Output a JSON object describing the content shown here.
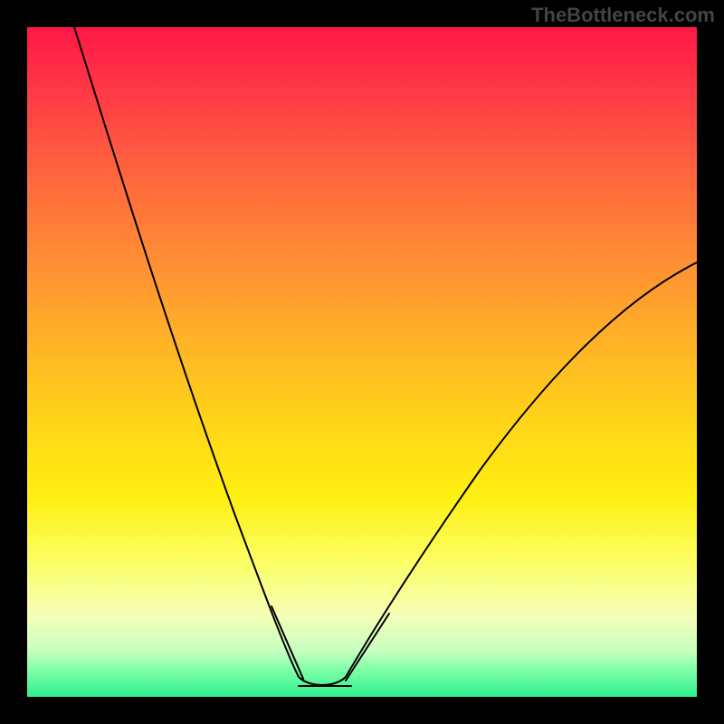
{
  "watermark": "TheBottleneck.com",
  "colors": {
    "gradient_top": "#ff1846",
    "gradient_mid": "#ffef10",
    "gradient_bottom": "#2df08f",
    "curve": "#000000",
    "highlight": "#e97276",
    "frame": "#000000"
  },
  "chart_data": {
    "type": "line",
    "title": "",
    "xlabel": "",
    "ylabel": "",
    "xlim": [
      0,
      100
    ],
    "ylim": [
      0,
      100
    ],
    "series": [
      {
        "name": "bottleneck-curve",
        "x": [
          7,
          10,
          14,
          18,
          22,
          26,
          30,
          33,
          36,
          38,
          40,
          42,
          44,
          46,
          48,
          52,
          56,
          60,
          66,
          74,
          82,
          90,
          100
        ],
        "y": [
          100,
          88,
          74,
          62,
          50,
          40,
          30,
          22,
          14,
          8,
          4,
          2,
          1,
          1,
          2,
          4,
          8,
          14,
          22,
          32,
          42,
          52,
          62
        ]
      }
    ],
    "highlight_segments": [
      {
        "name": "left-descent",
        "x_range": [
          33,
          40
        ],
        "y_range": [
          22,
          4
        ],
        "angle_deg": 68
      },
      {
        "name": "valley-floor",
        "x_range": [
          40,
          48
        ],
        "y_range": [
          2,
          2
        ],
        "angle_deg": 0
      },
      {
        "name": "right-ascent",
        "x_range": [
          48,
          55
        ],
        "y_range": [
          2,
          8
        ],
        "angle_deg": -55
      }
    ],
    "annotations": []
  }
}
